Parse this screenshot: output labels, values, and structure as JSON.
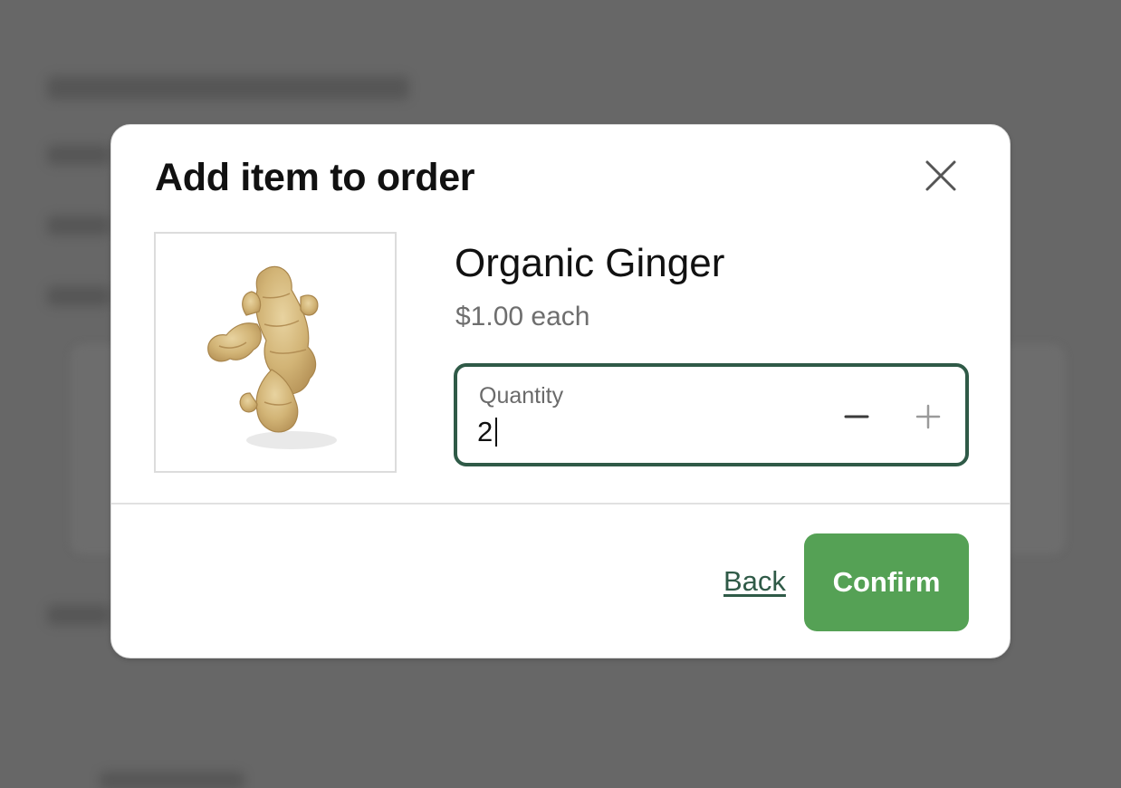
{
  "background": {
    "overlay_color": "#676767"
  },
  "modal": {
    "title": "Add item to order",
    "close_icon": "close-icon"
  },
  "product": {
    "image_icon": "ginger-root-image",
    "name": "Organic Ginger",
    "price": "$1.00 each"
  },
  "quantity": {
    "label": "Quantity",
    "value": "2",
    "decrement_icon": "minus-icon",
    "increment_icon": "plus-icon"
  },
  "footer": {
    "back_label": "Back",
    "confirm_label": "Confirm"
  },
  "colors": {
    "accent_green": "#55a155",
    "field_border": "#2f5a47",
    "link": "#2f5a47"
  }
}
